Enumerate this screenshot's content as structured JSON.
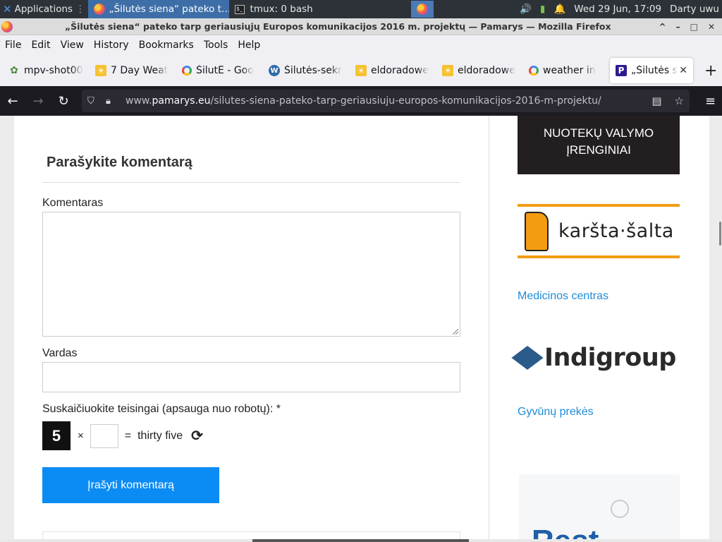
{
  "taskbar": {
    "apps_label": "Applications",
    "tasks": [
      {
        "label": "„Šilutės siena“ pateko t…"
      },
      {
        "label": "tmux: 0 bash"
      }
    ],
    "clock": "Wed 29 Jun, 17:09",
    "user": "Darty uwu"
  },
  "window": {
    "title": "„Šilutės siena“ pateko tarp geriausiųjų Europos komunikacijos 2016 m. projektų — Pamarys — Mozilla Firefox"
  },
  "menubar": {
    "items": [
      "File",
      "Edit",
      "View",
      "History",
      "Bookmarks",
      "Tools",
      "Help"
    ]
  },
  "tabs": [
    {
      "label": "mpv-shot00",
      "icon": "mpv-icon"
    },
    {
      "label": "7 Day Weat",
      "icon": "weather-icon"
    },
    {
      "label": "ŠilutĖ - Goo",
      "icon": "google-icon"
    },
    {
      "label": "Šilutės-sekr",
      "icon": "wordpress-icon"
    },
    {
      "label": "eldoradowe",
      "icon": "weather-icon"
    },
    {
      "label": "eldoradowe",
      "icon": "weather-icon"
    },
    {
      "label": "weather in",
      "icon": "google-icon"
    },
    {
      "label": "„Šilutės s",
      "icon": "pamarys-icon"
    }
  ],
  "urlbar": {
    "prefix": "www.",
    "host": "pamarys.eu",
    "path": "/silutes-siena-pateko-tarp-geriausiuju-europos-komunikacijos-2016-m-projektu/"
  },
  "comment_form": {
    "title": "Parašykite komentarą",
    "comment_label": "Komentaras",
    "comment_value": "",
    "name_label": "Vardas",
    "name_value": "",
    "captcha_label": "Suskaičiuokite teisingai (apsauga nuo robotų): *",
    "captcha_number": "5",
    "captcha_operator": "×",
    "captcha_equals": "=",
    "captcha_result": "thirty five",
    "submit_label": "Įrašyti komentarą"
  },
  "sidebar": {
    "ad1_line1": "NUOTEKŲ VALYMO",
    "ad1_line2": "ĮRENGINIAI",
    "ad2_text": "karšta·šalta",
    "link1": "Medicinos centras",
    "ad3_text": "Indigroup",
    "link2": "Gyvūnų prekės",
    "ad4_text": "Rest"
  },
  "colors": {
    "submit_button": "#0b8cf5",
    "link": "#1f8bd6",
    "accent_orange": "#f39c12"
  }
}
